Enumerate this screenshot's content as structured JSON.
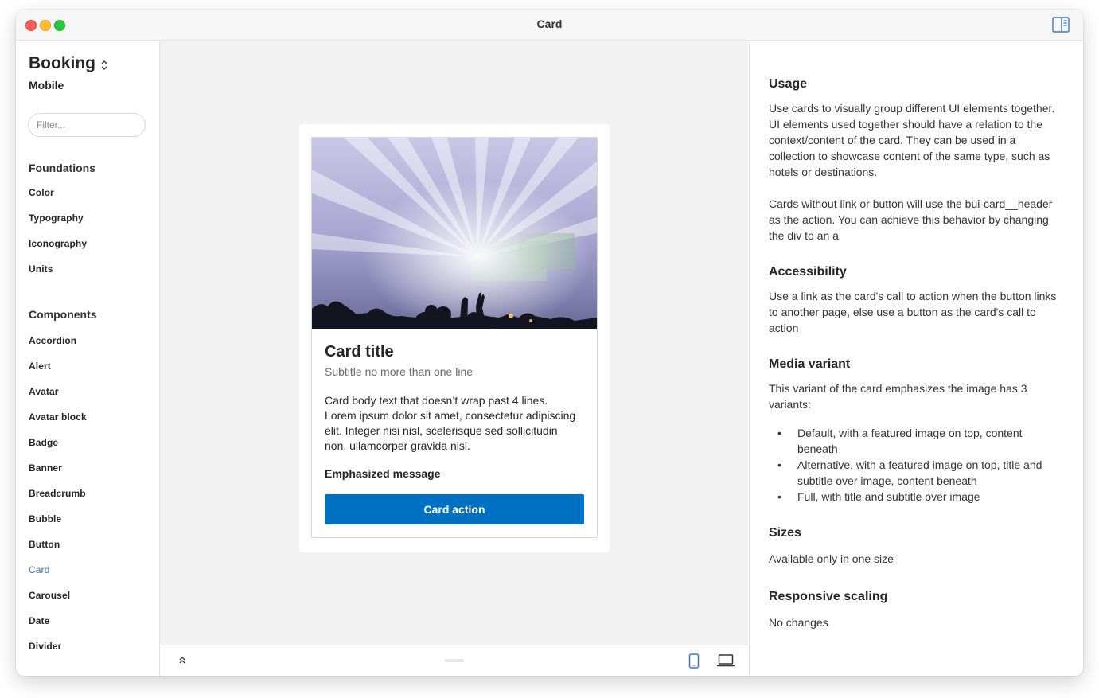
{
  "window": {
    "title": "Card"
  },
  "sidebar": {
    "brand": "Booking",
    "platform": "Mobile",
    "filter_placeholder": "Filter...",
    "foundations_title": "Foundations",
    "foundations": [
      "Color",
      "Typography",
      "Iconography",
      "Units"
    ],
    "components_title": "Components",
    "components": [
      "Accordion",
      "Alert",
      "Avatar",
      "Avatar block",
      "Badge",
      "Banner",
      "Breadcrumb",
      "Bubble",
      "Button",
      "Card",
      "Carousel",
      "Date",
      "Divider"
    ],
    "active_item": "Card"
  },
  "card": {
    "title": "Card title",
    "subtitle": "Subtitle no more than one line",
    "body": "Card body text that doesn’t wrap past 4 lines. Lorem ipsum dolor sit amet, consectetur adipiscing elit. Integer nisi nisl, scelerisque sed sollicitudin non, ullamcorper gravida nisi.",
    "emphasized": "Emphasized message",
    "action": "Card action"
  },
  "docs": {
    "usage_title": "Usage",
    "usage_p1": "Use cards to visually group different UI elements together. UI elements used together should have a relation to the context/content of the card. They can be used in a collection to showcase content of the same type, such as hotels or destinations.",
    "usage_p2": "Cards without link or button will use the bui-card__header as the action. You can achieve this behavior by changing the div to an a",
    "accessibility_title": "Accessibility",
    "accessibility_p": "Use a link as the card's call to action when the button links to another page, else use a button as the card's call to action",
    "media_title": "Media variant",
    "media_p": "This variant of the card emphasizes the image has 3 variants:",
    "media_list": [
      "Default, with a featured image on top, content beneath",
      "Alternative, with a featured image on top, title and subtitle over image, content beneath",
      "Full, with title and subtitle over image"
    ],
    "sizes_title": "Sizes",
    "sizes_p": "Available only in one size",
    "responsive_title": "Responsive scaling",
    "responsive_p": "No changes"
  },
  "colors": {
    "accent": "#0071c2",
    "active_nav": "#4a6fb5",
    "device_active": "#3b78c4"
  },
  "icons": {
    "panel_toggle": "sidebar-right-icon",
    "brand_switch": "chevron-up-down-icon",
    "collapse": "double-chevron-up-icon",
    "mobile": "mobile-device-icon",
    "desktop": "laptop-device-icon"
  }
}
